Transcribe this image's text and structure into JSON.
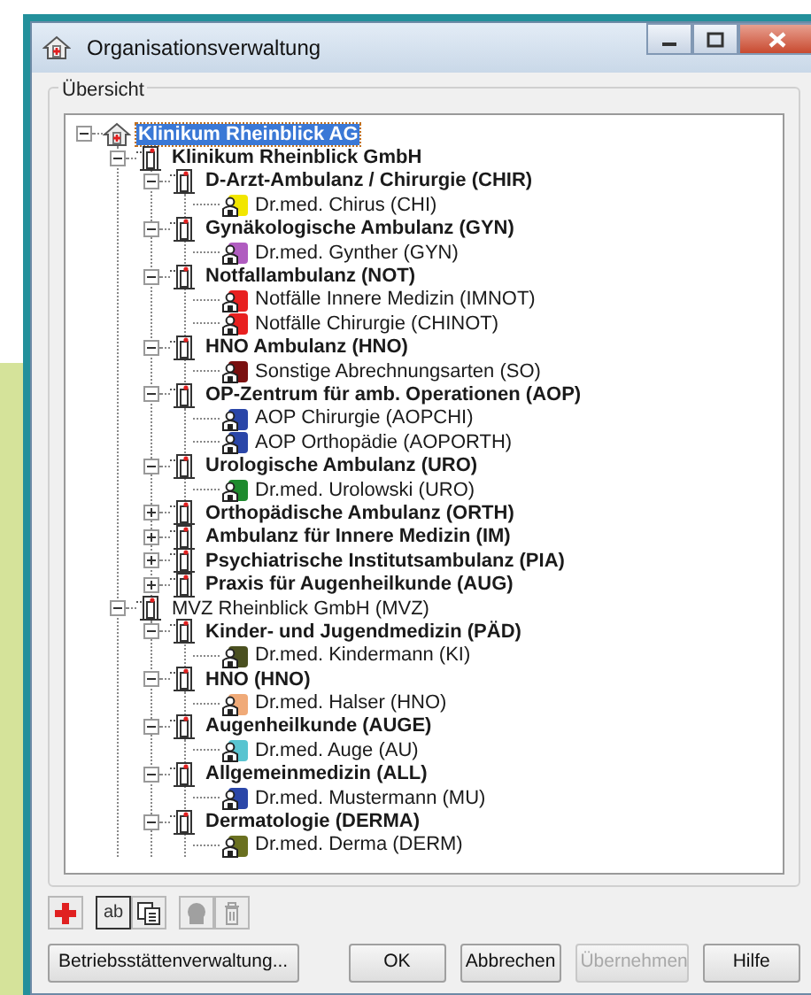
{
  "window": {
    "title": "Organisationsverwaltung"
  },
  "group": {
    "title": "Übersicht"
  },
  "tree": [
    {
      "label": "Klinikum Rheinblick AG",
      "kind": "company",
      "expanded": true,
      "selected": true,
      "bold": true,
      "children": [
        {
          "label": "Klinikum Rheinblick GmbH",
          "kind": "site",
          "expanded": true,
          "selected": false,
          "bold": true,
          "children": [
            {
              "label": "D-Arzt-Ambulanz / Chirurgie (CHIR)",
              "kind": "unit",
              "expanded": true,
              "selected": false,
              "bold": true,
              "children": [
                {
                  "label": "Dr.med. Chirus (CHI)",
                  "kind": "person",
                  "color": "#f2e600",
                  "selected": false,
                  "bold": false
                }
              ]
            },
            {
              "label": "Gynäkologische Ambulanz (GYN)",
              "kind": "unit",
              "expanded": true,
              "selected": false,
              "bold": true,
              "children": [
                {
                  "label": "Dr.med. Gynther (GYN)",
                  "kind": "person",
                  "color": "#b05cc0",
                  "selected": false,
                  "bold": false
                }
              ]
            },
            {
              "label": "Notfallambulanz (NOT)",
              "kind": "unit",
              "expanded": true,
              "selected": false,
              "bold": true,
              "children": [
                {
                  "label": "Notfälle Innere Medizin (IMNOT)",
                  "kind": "person",
                  "color": "#e82020",
                  "selected": false,
                  "bold": false
                },
                {
                  "label": "Notfälle Chirurgie (CHINOT)",
                  "kind": "person",
                  "color": "#e82020",
                  "selected": false,
                  "bold": false
                }
              ]
            },
            {
              "label": "HNO Ambulanz (HNO)",
              "kind": "unit",
              "expanded": true,
              "selected": false,
              "bold": true,
              "children": [
                {
                  "label": "Sonstige Abrechnungsarten (SO)",
                  "kind": "person",
                  "color": "#7a1010",
                  "selected": false,
                  "bold": false
                }
              ]
            },
            {
              "label": "OP-Zentrum für amb. Operationen (AOP)",
              "kind": "unit",
              "expanded": true,
              "selected": false,
              "bold": true,
              "children": [
                {
                  "label": "AOP Chirurgie (AOPCHI)",
                  "kind": "person",
                  "color": "#2a46a8",
                  "selected": false,
                  "bold": false
                },
                {
                  "label": "AOP Orthopädie (AOPORTH)",
                  "kind": "person",
                  "color": "#2a46a8",
                  "selected": false,
                  "bold": false
                }
              ]
            },
            {
              "label": "Urologische Ambulanz (URO)",
              "kind": "unit",
              "expanded": true,
              "selected": false,
              "bold": true,
              "children": [
                {
                  "label": "Dr.med. Urolowski (URO)",
                  "kind": "person",
                  "color": "#1e8a2e",
                  "selected": false,
                  "bold": false
                }
              ]
            },
            {
              "label": "Orthopädische Ambulanz (ORTH)",
              "kind": "unit",
              "expanded": false,
              "selected": false,
              "bold": true
            },
            {
              "label": "Ambulanz für Innere Medizin (IM)",
              "kind": "unit",
              "expanded": false,
              "selected": false,
              "bold": true
            },
            {
              "label": "Psychiatrische Institutsambulanz (PIA)",
              "kind": "unit",
              "expanded": false,
              "selected": false,
              "bold": true
            },
            {
              "label": "Praxis für Augenheilkunde (AUG)",
              "kind": "unit",
              "expanded": false,
              "selected": false,
              "bold": true
            }
          ]
        },
        {
          "label": "MVZ Rheinblick GmbH (MVZ)",
          "kind": "site",
          "expanded": true,
          "selected": false,
          "bold": false,
          "children": [
            {
              "label": "Kinder- und Jugendmedizin (PÄD)",
              "kind": "unit",
              "expanded": true,
              "selected": false,
              "bold": true,
              "children": [
                {
                  "label": "Dr.med. Kindermann (KI)",
                  "kind": "person",
                  "color": "#4a5020",
                  "selected": false,
                  "bold": false
                }
              ]
            },
            {
              "label": "HNO (HNO)",
              "kind": "unit",
              "expanded": true,
              "selected": false,
              "bold": true,
              "children": [
                {
                  "label": "Dr.med. Halser (HNO)",
                  "kind": "person",
                  "color": "#f0aa78",
                  "selected": false,
                  "bold": false
                }
              ]
            },
            {
              "label": "Augenheilkunde (AUGE)",
              "kind": "unit",
              "expanded": true,
              "selected": false,
              "bold": true,
              "children": [
                {
                  "label": "Dr.med. Auge (AU)",
                  "kind": "person",
                  "color": "#58c4d0",
                  "selected": false,
                  "bold": false
                }
              ]
            },
            {
              "label": "Allgemeinmedizin (ALL)",
              "kind": "unit",
              "expanded": true,
              "selected": false,
              "bold": true,
              "children": [
                {
                  "label": "Dr.med. Mustermann (MU)",
                  "kind": "person",
                  "color": "#2a46a8",
                  "selected": false,
                  "bold": false
                }
              ]
            },
            {
              "label": "Dermatologie (DERMA)",
              "kind": "unit",
              "expanded": true,
              "selected": false,
              "bold": true,
              "children": [
                {
                  "label": "Dr.med. Derma (DERM)",
                  "kind": "person",
                  "color": "#6a7020",
                  "selected": false,
                  "bold": false
                }
              ]
            }
          ]
        }
      ]
    }
  ],
  "toolbar": [
    {
      "kind": "add",
      "disabled": false
    },
    {
      "kind": "rename",
      "text": "ab",
      "disabled": false
    },
    {
      "kind": "copy",
      "disabled": false
    },
    {
      "kind": "assign",
      "disabled": true
    },
    {
      "kind": "delete",
      "disabled": true
    }
  ],
  "buttons": [
    {
      "label": "Betriebsstättenverwaltung...",
      "disabled": false
    },
    {
      "label": "OK",
      "disabled": false
    },
    {
      "label": "Abbrechen",
      "disabled": false
    },
    {
      "label": "Übernehmen",
      "disabled": true
    },
    {
      "label": "Hilfe",
      "disabled": false
    }
  ]
}
